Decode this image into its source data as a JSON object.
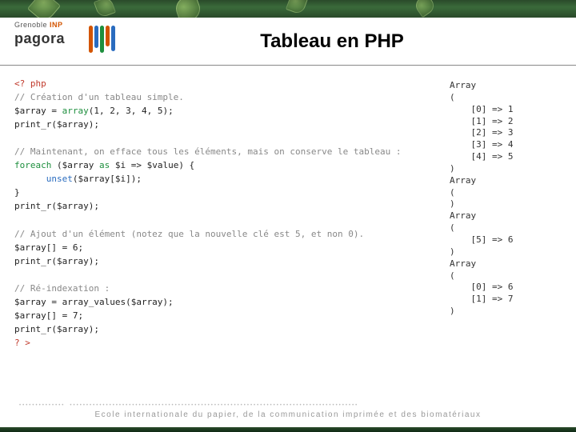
{
  "logo": {
    "line1_a": "Grenoble ",
    "line1_b": "INP",
    "line2": "pagora"
  },
  "title": "Tableau en PHP",
  "code": {
    "l1": "<? php",
    "l2": "// Création d'un tableau simple.",
    "l3a": "$array = ",
    "l3b": "array",
    "l3c": "(1",
    "l3d": ", 2, ",
    "l3e": "3",
    "l3f": ", 4, ",
    "l3g": "5",
    "l3h": ");",
    "l4": "print_r($array);",
    "l6": "// Maintenant, on efface tous les éléments, mais on conserve le tableau :",
    "l7a": "foreach ",
    "l7b": "($array ",
    "l7c": "as ",
    "l7d": "$i => $value) {",
    "l8a": "      unset",
    "l8b": "($array[$i]);",
    "l9": "}",
    "l10": "print_r($array);",
    "l12": "// Ajout d'un élément (notez que la nouvelle clé est 5, et non 0).",
    "l13": "$array[] = 6;",
    "l14": "print_r($array);",
    "l16": "// Ré-indexation :",
    "l17": "$array = array_values($array);",
    "l18": "$array[] = 7;",
    "l19": "print_r($array);",
    "l20": "? >"
  },
  "output": {
    "o1": "Array",
    "o2": "(",
    "o3": "    [0] => 1",
    "o4": "    [1] => 2",
    "o5": "    [2] => 3",
    "o6": "    [3] => 4",
    "o7": "    [4] => 5",
    "o8": ")",
    "o9": "Array",
    "o10": "(",
    "o11": ")",
    "o12": "Array",
    "o13": "(",
    "o14": "    [5] => 6",
    "o15": ")",
    "o16": "Array",
    "o17": "(",
    "o18": "    [0] => 6",
    "o19": "    [1] => 7",
    "o20": ")"
  },
  "footer": "Ecole internationale du papier, de la communication imprimée et des biomatériaux"
}
